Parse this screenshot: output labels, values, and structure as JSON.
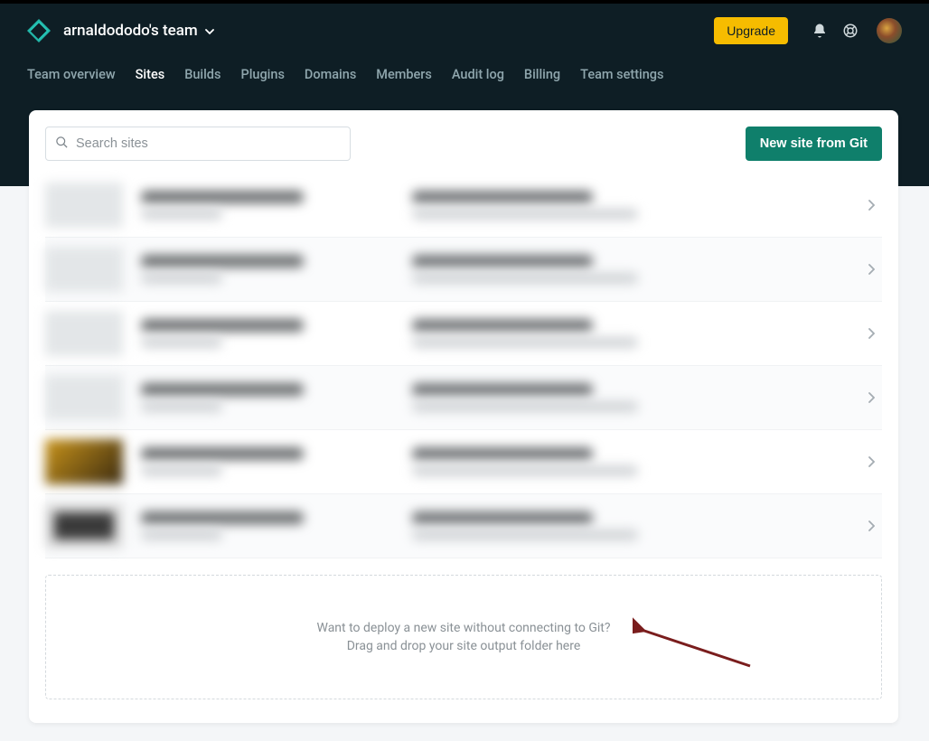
{
  "header": {
    "team_name": "arnaldododo's team",
    "upgrade_label": "Upgrade"
  },
  "nav": {
    "items": [
      {
        "label": "Team overview",
        "active": false
      },
      {
        "label": "Sites",
        "active": true
      },
      {
        "label": "Builds",
        "active": false
      },
      {
        "label": "Plugins",
        "active": false
      },
      {
        "label": "Domains",
        "active": false
      },
      {
        "label": "Members",
        "active": false
      },
      {
        "label": "Audit log",
        "active": false
      },
      {
        "label": "Billing",
        "active": false
      },
      {
        "label": "Team settings",
        "active": false
      }
    ]
  },
  "search": {
    "placeholder": "Search sites"
  },
  "actions": {
    "new_site_label": "New site from Git"
  },
  "sites": [
    {},
    {},
    {},
    {},
    {},
    {}
  ],
  "dropzone": {
    "line1": "Want to deploy a new site without connecting to Git?",
    "line2": "Drag and drop your site output folder here"
  },
  "colors": {
    "header_bg": "#0e1e25",
    "accent_teal": "#0f7f6b",
    "upgrade_gold": "#f6bc00"
  }
}
